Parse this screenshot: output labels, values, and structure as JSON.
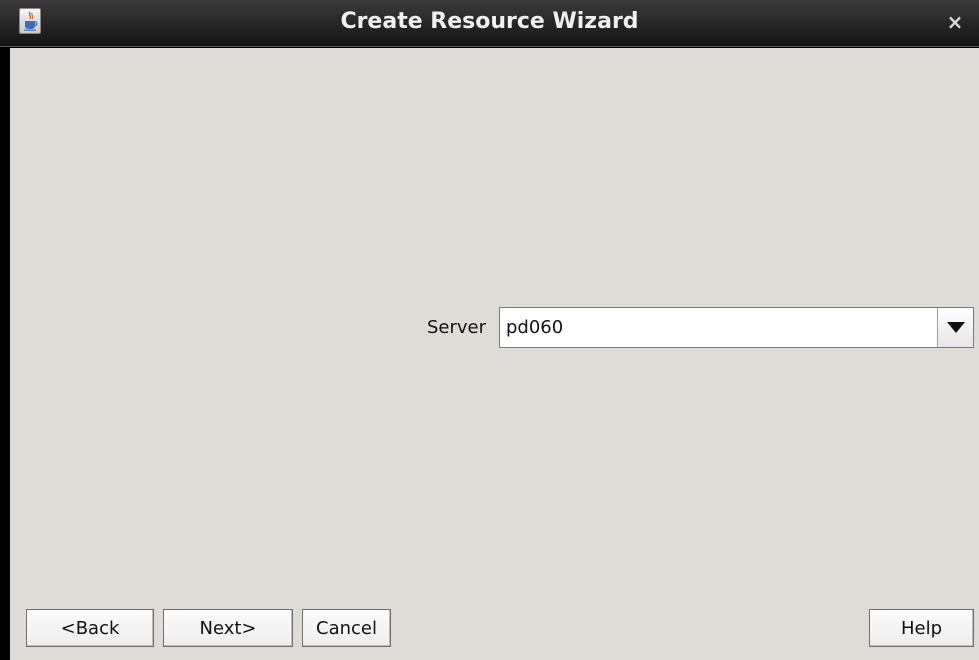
{
  "window": {
    "title": "Create Resource Wizard",
    "close_label": "×",
    "icon": "java-app-icon"
  },
  "form": {
    "server_label": "Server",
    "server_value": "pd060",
    "dropdown_icon": "triangle-down-icon"
  },
  "buttons": {
    "back": "<Back",
    "next": "Next>",
    "cancel": "Cancel",
    "help": "Help"
  },
  "colors": {
    "titlebar": "#1e1e1e",
    "content_bg": "#dfdcd8",
    "input_bg": "#ffffff"
  }
}
